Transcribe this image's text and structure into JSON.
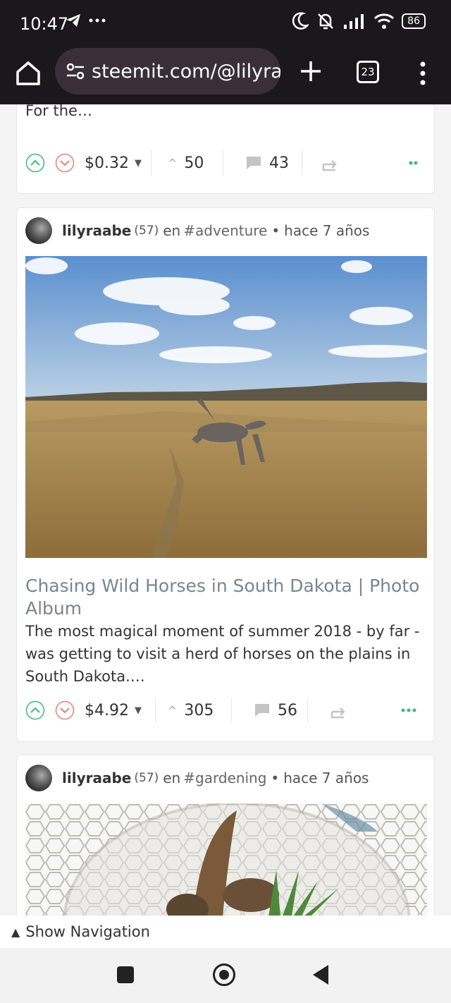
{
  "status_bar": {
    "time": "10:47",
    "battery": "86",
    "icons": [
      "telegram-icon",
      "more-dots-icon",
      "moon-icon",
      "mute-bell-icon",
      "signal-icon",
      "wifi-icon",
      "battery-icon"
    ]
  },
  "browser": {
    "url": "steemit.com/@lilyraab",
    "tab_count": "23",
    "icons": [
      "home-icon",
      "site-settings-icon",
      "new-tab-icon",
      "tabs-icon",
      "menu-icon"
    ]
  },
  "posts": [
    {
      "excerpt": "have been hearing about the U.S. midterm elections. For the…",
      "payout": "$0.32",
      "votes": "50",
      "comments": "43"
    },
    {
      "author": "lilyraabe",
      "reputation": "(57)",
      "prefix": "en",
      "tag": "#adventure",
      "age": "hace 7 años",
      "title": "Chasing Wild Horses in South Dakota | Photo Album",
      "excerpt": "The most magical moment of summer 2018 - by far - was getting to visit a herd of horses on the plains in South Dakota.…",
      "payout": "$4.92",
      "votes": "305",
      "comments": "56"
    },
    {
      "author": "lilyraabe",
      "reputation": "(57)",
      "prefix": "en",
      "tag": "#gardening",
      "age": "hace 7 años"
    }
  ],
  "show_navigation": "Show Navigation",
  "colors": {
    "upvote": "#3fb97f",
    "downvote": "#e88080",
    "title": "#79858f",
    "chrome": "#1c171c"
  }
}
